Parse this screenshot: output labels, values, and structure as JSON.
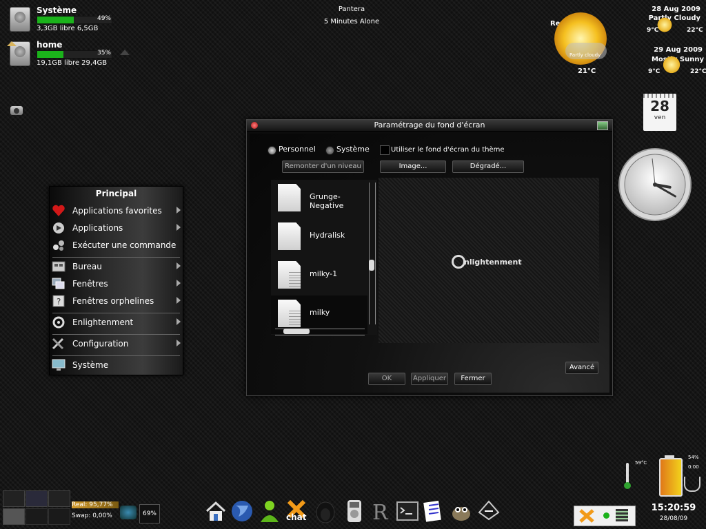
{
  "top_center": {
    "line1": "Pantera",
    "line2": "5 Minutes Alone"
  },
  "drives": [
    {
      "name": "Système",
      "percent_label": "49%",
      "fill_fraction": 0.49,
      "free": "3,3GB libre 6,5GB"
    },
    {
      "name": "home",
      "percent_label": "35%",
      "fill_fraction": 0.35,
      "free": "19,1GB libre 29,4GB"
    }
  ],
  "weather": {
    "city": "Rennes",
    "current_condition": "Partly cloudy",
    "current_temp": "21°C",
    "forecast": [
      {
        "date": "28 Aug 2009",
        "condition": "Partly Cloudy",
        "low": "9°C",
        "high": "22°C"
      },
      {
        "date": "29 Aug 2009",
        "condition": "Mostly Sunny",
        "low": "9°C",
        "high": "22°C"
      }
    ]
  },
  "calendar": {
    "day": "28",
    "weekday": "ven"
  },
  "clock": {
    "hour": 3,
    "minute": 20,
    "second": 59
  },
  "menu": {
    "title": "Principal",
    "items": [
      {
        "label": "Applications favorites",
        "icon": "heart-icon",
        "submenu": true
      },
      {
        "label": "Applications",
        "icon": "play-icon",
        "submenu": true
      },
      {
        "label": "Exécuter une commande",
        "icon": "run-command-icon",
        "submenu": false
      },
      {
        "label": "Bureau",
        "icon": "desktop-icon",
        "submenu": true
      },
      {
        "label": "Fenêtres",
        "icon": "windows-icon",
        "submenu": true
      },
      {
        "label": "Fenêtres orphelines",
        "icon": "orphan-windows-icon",
        "submenu": true
      },
      {
        "label": "Enlightenment",
        "icon": "enlightenment-icon",
        "submenu": true
      },
      {
        "label": "Configuration",
        "icon": "tools-icon",
        "submenu": true
      },
      {
        "label": "Système",
        "icon": "monitor-icon",
        "submenu": false
      }
    ]
  },
  "dialog": {
    "title": "Paramétrage du fond d'écran",
    "radio_personal": "Personnel",
    "radio_system": "Système",
    "selected_radio": "Personnel",
    "theme_checkbox": "Utiliser le fond d'écran du thème",
    "up_level_button": "Remonter d'un niveau",
    "image_button": "Image...",
    "gradient_button": "Dégradé...",
    "files": [
      "Grunge-Negative",
      "Hydralisk",
      "milky-1",
      "milky"
    ],
    "preview_logo": "nlightenment",
    "advanced_button": "Avancé",
    "ok_button": "OK",
    "apply_button": "Appliquer",
    "close_button": "Fermer"
  },
  "system_monitor": {
    "real": "Real: 95,77%",
    "swap": "Swap: 0,00%",
    "cpu": "69%"
  },
  "taskbar": {
    "icons": [
      "home-icon",
      "globe-icon",
      "messenger-icon",
      "chat-icon",
      "penguin-icon",
      "media-player-icon",
      "r-logo-icon",
      "terminal-icon",
      "text-editor-icon",
      "gimp-icon",
      "inkscape-icon"
    ],
    "chat_label": "chat"
  },
  "thermometer": {
    "temp": "59°C"
  },
  "battery": {
    "percent": "54%",
    "time": "0:00"
  },
  "tray_clock": {
    "time": "15:20:59",
    "date": "28/08/09"
  },
  "colors": {
    "accent_green": "#1bb21b",
    "battery_yellow": "#f2d21b",
    "battery_orange": "#e0781a"
  }
}
